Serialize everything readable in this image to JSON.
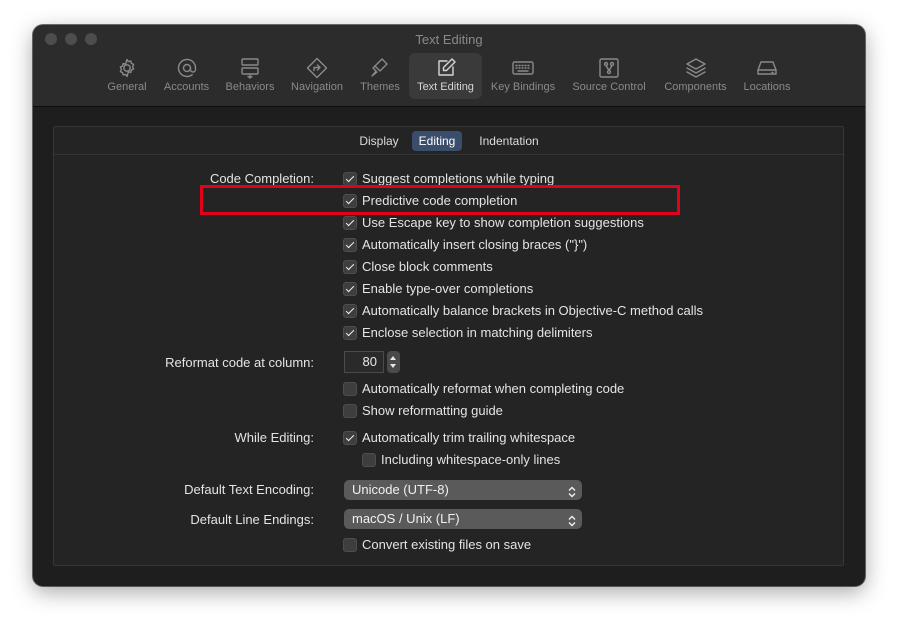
{
  "window": {
    "title": "Text Editing"
  },
  "tabs": [
    {
      "label": "General",
      "icon": "gear-icon"
    },
    {
      "label": "Accounts",
      "icon": "at-icon"
    },
    {
      "label": "Behaviors",
      "icon": "behaviors-icon"
    },
    {
      "label": "Navigation",
      "icon": "navigation-icon"
    },
    {
      "label": "Themes",
      "icon": "brush-icon"
    },
    {
      "label": "Text Editing",
      "icon": "pencil-square-icon",
      "selected": true
    },
    {
      "label": "Key Bindings",
      "icon": "keyboard-icon"
    },
    {
      "label": "Source Control",
      "icon": "source-control-icon"
    },
    {
      "label": "Components",
      "icon": "layers-icon"
    },
    {
      "label": "Locations",
      "icon": "drive-icon"
    }
  ],
  "segments": [
    {
      "label": "Display"
    },
    {
      "label": "Editing",
      "active": true
    },
    {
      "label": "Indentation"
    }
  ],
  "code_completion": {
    "label": "Code Completion:",
    "options": [
      {
        "label": "Suggest completions while typing",
        "checked": true
      },
      {
        "label": "Predictive code completion",
        "checked": true
      },
      {
        "label": "Use Escape key to show completion suggestions",
        "checked": true
      },
      {
        "label": "Automatically insert closing braces (\"}\")",
        "checked": true
      },
      {
        "label": "Close block comments",
        "checked": true
      },
      {
        "label": "Enable type-over completions",
        "checked": true
      },
      {
        "label": "Automatically balance brackets in Objective-C method calls",
        "checked": true
      },
      {
        "label": "Enclose selection in matching delimiters",
        "checked": true
      }
    ]
  },
  "reformat": {
    "label": "Reformat code at column:",
    "column": "80",
    "options": [
      {
        "label": "Automatically reformat when completing code",
        "checked": false
      },
      {
        "label": "Show reformatting guide",
        "checked": false
      }
    ]
  },
  "while_editing": {
    "label": "While Editing:",
    "options": [
      {
        "label": "Automatically trim trailing whitespace",
        "checked": true
      },
      {
        "label": "Including whitespace-only lines",
        "checked": false
      }
    ]
  },
  "encoding": {
    "label": "Default Text Encoding:",
    "value": "Unicode (UTF-8)"
  },
  "line_endings": {
    "label": "Default Line Endings:",
    "value": "macOS / Unix (LF)",
    "convert_option": {
      "label": "Convert existing files on save",
      "checked": false
    }
  },
  "colors": {
    "highlight": "#e3001b",
    "active_segment": "#3a4d6b"
  }
}
